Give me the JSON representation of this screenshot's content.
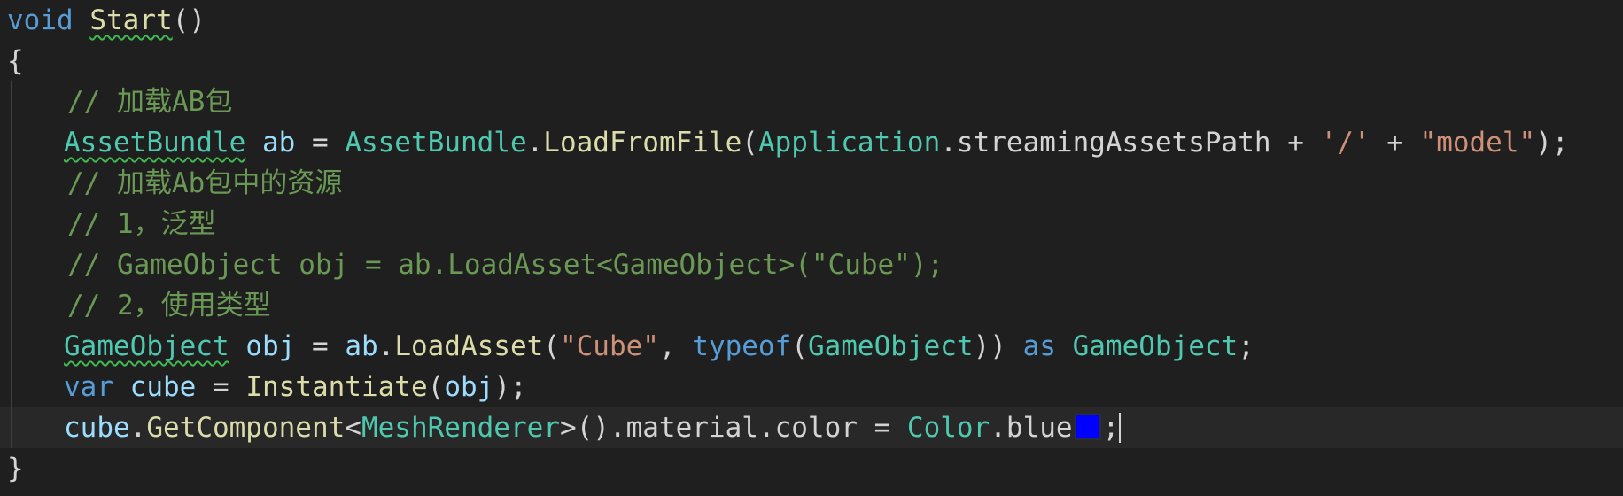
{
  "code": {
    "kw_void": "void",
    "fn_start": "Start",
    "punct_parens": "()",
    "brace_open": "{",
    "brace_close": "}",
    "comment_load_ab": "// 加载AB包",
    "type_assetbundle": "AssetBundle",
    "var_ab": "ab",
    "op_assign": " = ",
    "fn_loadfromfile": "LoadFromFile",
    "type_application": "Application",
    "member_streamingassetspath": "streamingAssetsPath",
    "op_plus": " + ",
    "str_slash": "'/'",
    "str_model": "\"model\"",
    "comment_load_resource": "// 加载Ab包中的资源",
    "comment_generic": "// 1，泛型",
    "comment_generic_code": "// GameObject obj = ab.LoadAsset<GameObject>(\"Cube\");",
    "comment_use_type": "// 2，使用类型",
    "type_gameobject": "GameObject",
    "var_obj": "obj",
    "fn_loadasset": "LoadAsset",
    "str_cube": "\"Cube\"",
    "kw_typeof": "typeof",
    "kw_as": "as",
    "kw_var": "var",
    "var_cube": "cube",
    "fn_instantiate": "Instantiate",
    "fn_getcomponent": "GetComponent",
    "type_meshrenderer": "MeshRenderer",
    "member_material": "material",
    "member_color": "color",
    "type_color": "Color",
    "member_blue": "blue"
  },
  "colors": {
    "background": "#1f1f1f",
    "keyword": "#569cd6",
    "type": "#4ec9b0",
    "function": "#dcdcaa",
    "variable": "#9cdcfe",
    "string": "#ce9178",
    "comment": "#6a9955",
    "swatch_blue": "#0000ff"
  }
}
